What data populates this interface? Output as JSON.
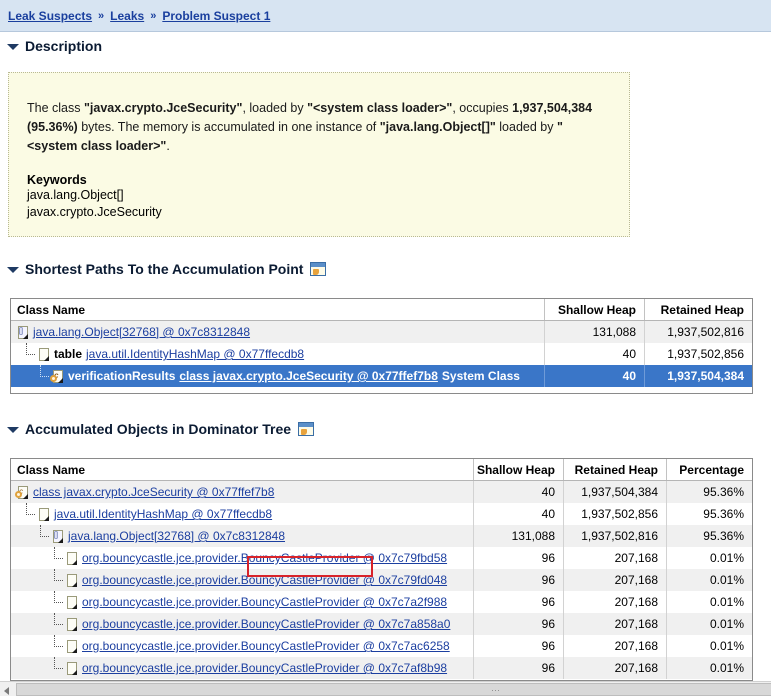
{
  "breadcrumb": {
    "items": [
      {
        "label": "Leak Suspects"
      },
      {
        "label": "Leaks"
      },
      {
        "label": "Problem Suspect 1"
      }
    ],
    "separator": "»"
  },
  "sections": {
    "description": {
      "title": "Description"
    },
    "shortest_paths": {
      "title": "Shortest Paths To the Accumulation Point"
    },
    "accumulated": {
      "title": "Accumulated Objects in Dominator Tree"
    }
  },
  "description": {
    "p1_a": "The class ",
    "p1_class": "\"javax.crypto.JceSecurity\"",
    "p1_b": ", loaded by ",
    "p1_loader": "\"<system class loader>\"",
    "p1_c": ", occupies ",
    "p1_bytes": "1,937,504,384 (95.36%)",
    "p1_d": " bytes. The memory is accumulated in one instance of ",
    "p1_instance": "\"java.lang.Object[]\"",
    "p1_e": " loaded by ",
    "p1_loader2": "\"<system class loader>\"",
    "p1_f": ".",
    "keywords_label": "Keywords",
    "keywords": [
      "java.lang.Object[]",
      "javax.crypto.JceSecurity"
    ]
  },
  "shortest_paths_table": {
    "columns": [
      "Class Name",
      "Shallow Heap",
      "Retained Heap"
    ],
    "rows": [
      {
        "depth": 0,
        "icon": "array-object-icon",
        "field": "",
        "link": "java.lang.Object[32768] @ 0x7c8312848",
        "suffix": "",
        "shallow": "131,088",
        "retained": "1,937,502,816",
        "selected": false,
        "alt": true
      },
      {
        "depth": 1,
        "icon": "object-instance-icon",
        "field": "table",
        "link": "java.util.IdentityHashMap @ 0x77ffecdb8",
        "suffix": "",
        "shallow": "40",
        "retained": "1,937,502,856",
        "selected": false,
        "alt": false
      },
      {
        "depth": 2,
        "icon": "class-icon",
        "field": "verificationResults",
        "link": "class javax.crypto.JceSecurity @ 0x77ffef7b8",
        "suffix": "System Class",
        "shallow": "40",
        "retained": "1,937,504,384",
        "selected": true,
        "alt": false
      }
    ]
  },
  "accumulated_table": {
    "columns": [
      "Class Name",
      "Shallow Heap",
      "Retained Heap",
      "Percentage"
    ],
    "rows": [
      {
        "depth": 0,
        "icon": "class-icon",
        "link": "class javax.crypto.JceSecurity @ 0x77ffef7b8",
        "shallow": "40",
        "retained": "1,937,504,384",
        "percentage": "95.36%",
        "alt": true
      },
      {
        "depth": 1,
        "icon": "object-instance-icon",
        "link": "java.util.IdentityHashMap @ 0x77ffecdb8",
        "shallow": "40",
        "retained": "1,937,502,856",
        "percentage": "95.36%",
        "alt": false
      },
      {
        "depth": 2,
        "icon": "array-object-icon",
        "link": "java.lang.Object[32768] @ 0x7c8312848",
        "shallow": "131,088",
        "retained": "1,937,502,816",
        "percentage": "95.36%",
        "alt": true
      },
      {
        "depth": 3,
        "icon": "object-instance-icon",
        "link": "org.bouncycastle.jce.provider.BouncyCastleProvider @ 0x7c79fbd58",
        "shallow": "96",
        "retained": "207,168",
        "percentage": "0.01%",
        "alt": false,
        "highlight": true
      },
      {
        "depth": 3,
        "icon": "object-instance-icon",
        "link": "org.bouncycastle.jce.provider.BouncyCastleProvider @ 0x7c79fd048",
        "shallow": "96",
        "retained": "207,168",
        "percentage": "0.01%",
        "alt": true
      },
      {
        "depth": 3,
        "icon": "object-instance-icon",
        "link": "org.bouncycastle.jce.provider.BouncyCastleProvider @ 0x7c7a2f988",
        "shallow": "96",
        "retained": "207,168",
        "percentage": "0.01%",
        "alt": false
      },
      {
        "depth": 3,
        "icon": "object-instance-icon",
        "link": "org.bouncycastle.jce.provider.BouncyCastleProvider @ 0x7c7a858a0",
        "shallow": "96",
        "retained": "207,168",
        "percentage": "0.01%",
        "alt": true
      },
      {
        "depth": 3,
        "icon": "object-instance-icon",
        "link": "org.bouncycastle.jce.provider.BouncyCastleProvider @ 0x7c7ac6258",
        "shallow": "96",
        "retained": "207,168",
        "percentage": "0.01%",
        "alt": false
      },
      {
        "depth": 3,
        "icon": "object-instance-icon",
        "link": "org.bouncycastle.jce.provider.BouncyCastleProvider @ 0x7c7af8b98",
        "shallow": "96",
        "retained": "207,168",
        "percentage": "0.01%",
        "alt": true
      }
    ]
  },
  "annotation": {
    "type": "red-rectangle",
    "color": "#d8232a",
    "target_text": "BouncyCastleProvider"
  },
  "colors": {
    "breadcrumb_bg": "#d7e4f2",
    "link": "#1c3fa0",
    "description_bg": "#fbfbe4",
    "selected_row": "#3a76c8",
    "alt_row": "#f0f0f0",
    "annotation": "#d8232a"
  },
  "scrollbar": {
    "grip": "⋯"
  }
}
